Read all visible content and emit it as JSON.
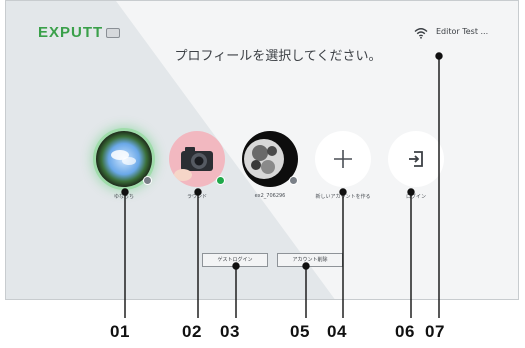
{
  "app": {
    "logo_text": "EXPUTT",
    "prompt": "プロフィールを選択してください。",
    "device_name": "Editor Test ..."
  },
  "profiles": [
    {
      "label": "ゆなっち",
      "status": "offline",
      "avatar": "fisheye-sky-photo"
    },
    {
      "label": "ラウンド",
      "status": "online",
      "avatar": "camera-photo"
    },
    {
      "label": "ex2_706296",
      "status": "offline",
      "avatar": "fractal-image"
    }
  ],
  "actions": {
    "add_label": "新しいアカウントを作る",
    "login_label": "ログイン"
  },
  "buttons": {
    "guest_login": "ゲストログイン",
    "delete_account": "アカウント削除"
  },
  "callouts": [
    "01",
    "02",
    "03",
    "05",
    "04",
    "06",
    "07"
  ],
  "colors": {
    "accent_green": "#3aa04a",
    "online": "#1fa84a",
    "offline": "#7a8088"
  },
  "icons": {
    "wifi": "wifi-icon",
    "add": "plus-icon",
    "login": "login-icon"
  }
}
